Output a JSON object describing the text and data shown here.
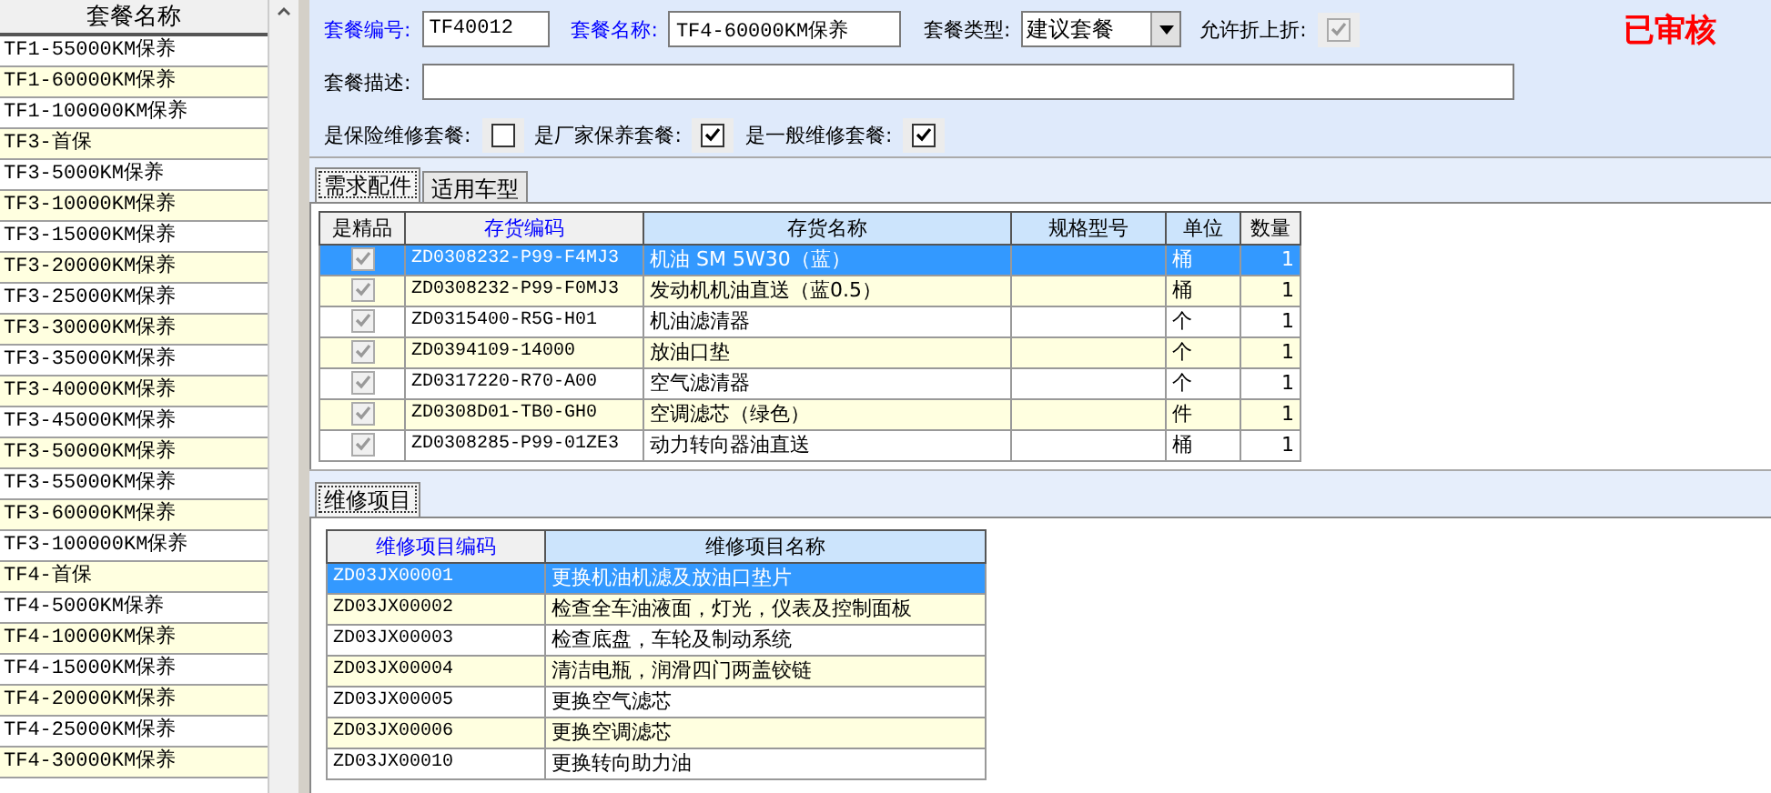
{
  "package_list": {
    "header": "套餐名称",
    "items": [
      {
        "name": "TF1-55000KM保养",
        "selected": false
      },
      {
        "name": "TF1-60000KM保养",
        "selected": false
      },
      {
        "name": "TF1-100000KM保养",
        "selected": false
      },
      {
        "name": "TF3-首保",
        "selected": false
      },
      {
        "name": "TF3-5000KM保养",
        "selected": false
      },
      {
        "name": "TF3-10000KM保养",
        "selected": false
      },
      {
        "name": "TF3-15000KM保养",
        "selected": false
      },
      {
        "name": "TF3-20000KM保养",
        "selected": false
      },
      {
        "name": "TF3-25000KM保养",
        "selected": false
      },
      {
        "name": "TF3-30000KM保养",
        "selected": false
      },
      {
        "name": "TF3-35000KM保养",
        "selected": false
      },
      {
        "name": "TF3-40000KM保养",
        "selected": false
      },
      {
        "name": "TF3-45000KM保养",
        "selected": false
      },
      {
        "name": "TF3-50000KM保养",
        "selected": false
      },
      {
        "name": "TF3-55000KM保养",
        "selected": false
      },
      {
        "name": "TF3-60000KM保养",
        "selected": false
      },
      {
        "name": "TF3-100000KM保养",
        "selected": false
      },
      {
        "name": "TF4-首保",
        "selected": false
      },
      {
        "name": "TF4-5000KM保养",
        "selected": false
      },
      {
        "name": "TF4-10000KM保养",
        "selected": false
      },
      {
        "name": "TF4-15000KM保养",
        "selected": false
      },
      {
        "name": "TF4-20000KM保养",
        "selected": false
      },
      {
        "name": "TF4-25000KM保养",
        "selected": false
      },
      {
        "name": "TF4-30000KM保养",
        "selected": false
      }
    ]
  },
  "form": {
    "code_label": "套餐编号:",
    "code_value": "TF40012",
    "code_required": true,
    "name_label": "套餐名称:",
    "name_value": "TF4-60000KM保养",
    "name_required": true,
    "type_label": "套餐类型:",
    "type_value": "建议套餐",
    "discount_label": "允许折上折:",
    "discount_checked": true,
    "status": "已审核",
    "desc_label": "套餐描述:",
    "flags": [
      {
        "label": "是保险维修套餐:",
        "checked": false
      },
      {
        "label": "是厂家保养套餐:",
        "checked": true
      },
      {
        "label": "是一般维修套餐:",
        "checked": true
      }
    ]
  },
  "parts_tabs": [
    {
      "label": "需求配件",
      "selected": true
    },
    {
      "label": "适用车型",
      "selected": false
    }
  ],
  "parts_table": {
    "columns": [
      {
        "label": "是精品",
        "kind": "plain"
      },
      {
        "label": "存货编码",
        "kind": "key"
      },
      {
        "label": "存货名称",
        "kind": "sorted"
      },
      {
        "label": "规格型号",
        "kind": "sorted"
      },
      {
        "label": "单位",
        "kind": "sorted"
      },
      {
        "label": "数量",
        "kind": "plain"
      }
    ],
    "rows": [
      {
        "premium": true,
        "code": "ZD0308232-P99-F4MJ3",
        "name": "机油 SM 5W30（蓝）",
        "unit": "桶",
        "qty": "1",
        "selected": true
      },
      {
        "premium": true,
        "code": "ZD0308232-P99-F0MJ3",
        "name": "发动机机油直送（蓝0.5）",
        "unit": "桶",
        "qty": "1",
        "selected": false
      },
      {
        "premium": true,
        "code": "ZD0315400-R5G-H01",
        "name": "机油滤清器",
        "unit": "个",
        "qty": "1",
        "selected": false
      },
      {
        "premium": true,
        "code": "ZD0394109-14000",
        "name": "放油口垫",
        "unit": "个",
        "qty": "1",
        "selected": false
      },
      {
        "premium": true,
        "code": "ZD0317220-R70-A00",
        "name": "空气滤清器",
        "unit": "个",
        "qty": "1",
        "selected": false
      },
      {
        "premium": true,
        "code": "ZD0308D01-TB0-GH0",
        "name": "空调滤芯（绿色）",
        "unit": "件",
        "qty": "1",
        "selected": false
      },
      {
        "premium": true,
        "code": "ZD0308285-P99-01ZE3",
        "name": "动力转向器油直送",
        "unit": "桶",
        "qty": "1",
        "selected": false
      }
    ]
  },
  "repair_tabs": [
    {
      "label": "维修项目",
      "selected": true
    }
  ],
  "repair_table": {
    "columns": [
      {
        "label": "维修项目编码",
        "kind": "key"
      },
      {
        "label": "维修项目名称",
        "kind": "sorted"
      }
    ],
    "rows": [
      {
        "code": "ZD03JX00001",
        "name": "更换机油机滤及放油口垫片",
        "selected": true
      },
      {
        "code": "ZD03JX00002",
        "name": "检查全车油液面，灯光，仪表及控制面板",
        "selected": false
      },
      {
        "code": "ZD03JX00003",
        "name": "检查底盘，车轮及制动系统",
        "selected": false
      },
      {
        "code": "ZD03JX00004",
        "name": "清洁电瓶，润滑四门两盖铰链",
        "selected": false
      },
      {
        "code": "ZD03JX00005",
        "name": "更换空气滤芯",
        "selected": false
      },
      {
        "code": "ZD03JX00006",
        "name": "更换空调滤芯",
        "selected": false
      },
      {
        "code": "ZD03JX00010",
        "name": "更换转向助力油",
        "selected": false
      }
    ]
  }
}
